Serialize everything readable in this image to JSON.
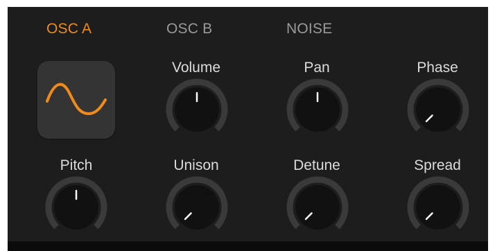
{
  "tabs": [
    {
      "label": "OSC A",
      "active": true
    },
    {
      "label": "OSC B",
      "active": false
    },
    {
      "label": "NOISE",
      "active": false
    }
  ],
  "waveform": {
    "icon": "sine-wave-icon",
    "color": "#f08b1c"
  },
  "knobs": {
    "volume": {
      "label": "Volume",
      "value": 0.5
    },
    "pan": {
      "label": "Pan",
      "value": 0.5
    },
    "phase": {
      "label": "Phase",
      "value": 0.0
    },
    "pitch": {
      "label": "Pitch",
      "value": 0.5
    },
    "unison": {
      "label": "Unison",
      "value": 0.0
    },
    "detune": {
      "label": "Detune",
      "value": 0.0
    },
    "spread": {
      "label": "Spread",
      "value": 0.0
    }
  },
  "colors": {
    "panel_bg": "#1d1d1d",
    "active_tab": "#f08b1c",
    "inactive_tab": "#9a9a9a",
    "knob_track": "#3a3a3a",
    "knob_body": "#111111",
    "knob_indicator": "#ffffff"
  }
}
